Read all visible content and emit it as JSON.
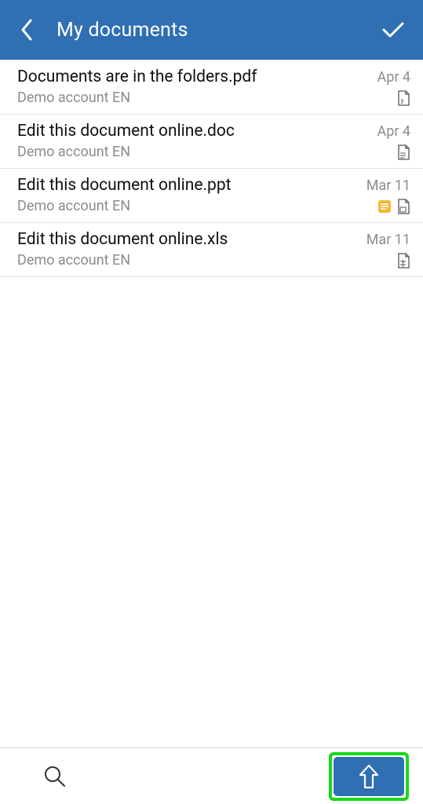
{
  "header": {
    "title": "My documents"
  },
  "documents": [
    {
      "title": "Documents are in the folders.pdf",
      "subtitle": "Demo account EN",
      "date": "Apr 4",
      "icon": "pdf",
      "tagged": false
    },
    {
      "title": "Edit this document online.doc",
      "subtitle": "Demo account EN",
      "date": "Apr 4",
      "icon": "doc",
      "tagged": false
    },
    {
      "title": "Edit this document online.ppt",
      "subtitle": "Demo account EN",
      "date": "Mar 11",
      "icon": "ppt",
      "tagged": true
    },
    {
      "title": "Edit this document online.xls",
      "subtitle": "Demo account EN",
      "date": "Mar 11",
      "icon": "xls",
      "tagged": false
    }
  ]
}
